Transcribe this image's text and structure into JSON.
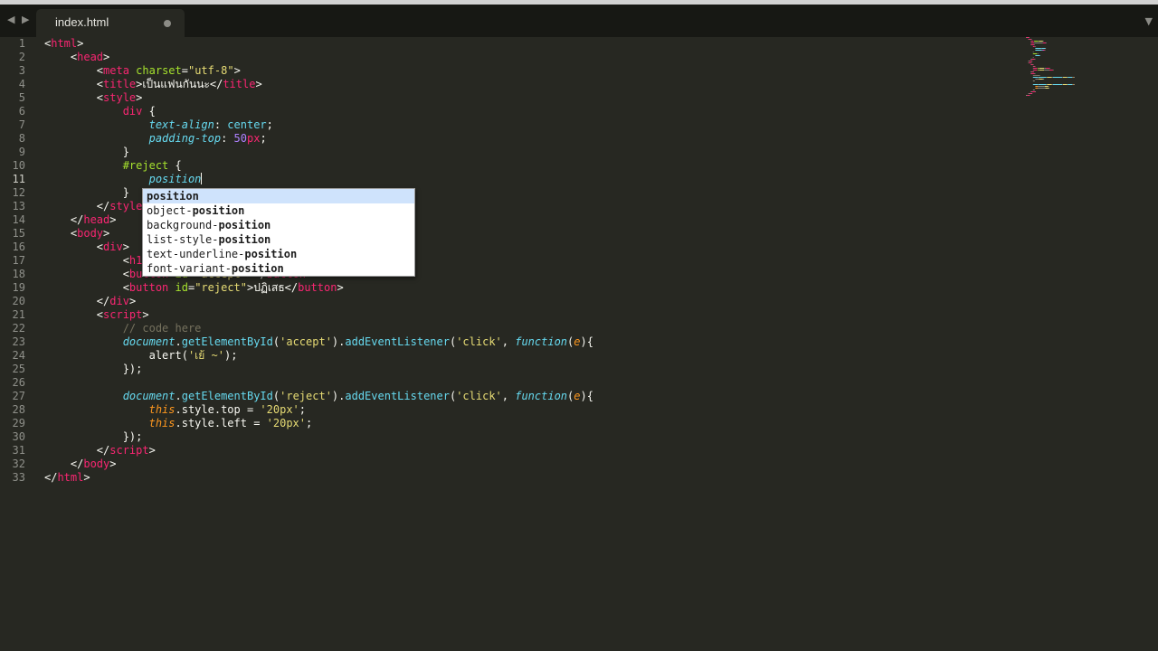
{
  "tabbar": {
    "nav_left_icon": "chevron-left-icon",
    "nav_right_icon": "chevron-right-icon",
    "nav_left_glyph": "◀",
    "nav_right_glyph": "▶",
    "menu_glyph": "▼",
    "tab_title": "index.html",
    "tab_modified": true
  },
  "colors": {
    "background": "#272822",
    "tag": "#f92672",
    "attribute": "#a6e22e",
    "string": "#e6db74",
    "number": "#ae81ff",
    "comment": "#75715e",
    "function": "#66d9ef"
  },
  "editor": {
    "active_line": 11,
    "line_numbers": [
      "1",
      "2",
      "3",
      "4",
      "5",
      "6",
      "7",
      "8",
      "9",
      "10",
      "11",
      "12",
      "13",
      "14",
      "15",
      "16",
      "17",
      "18",
      "19",
      "20",
      "21",
      "22",
      "23",
      "24",
      "25",
      "26",
      "27",
      "28",
      "29",
      "30",
      "31",
      "32",
      "33"
    ],
    "lines": {
      "l1": [
        [
          "",
          "<"
        ],
        [
          "tg",
          "html"
        ],
        [
          "",
          ">"
        ]
      ],
      "l2": [
        [
          "",
          "    <"
        ],
        [
          "tg",
          "head"
        ],
        [
          "",
          ">"
        ]
      ],
      "l3": [
        [
          "",
          "        <"
        ],
        [
          "tg",
          "meta"
        ],
        [
          "",
          " "
        ],
        [
          "at",
          "charset"
        ],
        [
          "",
          "="
        ],
        [
          "st",
          "\"utf-8\""
        ],
        [
          "",
          ">"
        ]
      ],
      "l4": [
        [
          "",
          "        <"
        ],
        [
          "tg",
          "title"
        ],
        [
          "",
          ">เป็นแฟนกันนะ</"
        ],
        [
          "tg",
          "title"
        ],
        [
          "",
          ">"
        ]
      ],
      "l5": [
        [
          "",
          "        <"
        ],
        [
          "tg",
          "style"
        ],
        [
          "",
          ">"
        ]
      ],
      "l6": [
        [
          "",
          "            "
        ],
        [
          "tg",
          "div"
        ],
        [
          "",
          " {"
        ]
      ],
      "l7": [
        [
          "",
          "                "
        ],
        [
          "cp",
          "text-align"
        ],
        [
          "",
          ": "
        ],
        [
          "fn",
          "center"
        ],
        [
          "",
          ";"
        ]
      ],
      "l8": [
        [
          "",
          "                "
        ],
        [
          "cp",
          "padding-top"
        ],
        [
          "",
          ": "
        ],
        [
          "nm",
          "50"
        ],
        [
          "kw",
          "px"
        ],
        [
          "",
          ";"
        ]
      ],
      "l9": [
        [
          "",
          "            }"
        ]
      ],
      "l10": [
        [
          "",
          "            "
        ],
        [
          "id",
          "#reject"
        ],
        [
          "",
          " {"
        ]
      ],
      "l11": [
        [
          "",
          "                "
        ],
        [
          "cp",
          "position"
        ]
      ],
      "l12": [
        [
          "",
          "            }"
        ]
      ],
      "l13": [
        [
          "",
          "        </"
        ],
        [
          "tg",
          "style"
        ],
        [
          "",
          ">"
        ]
      ],
      "l14": [
        [
          "",
          "    </"
        ],
        [
          "tg",
          "head"
        ],
        [
          "",
          ">"
        ]
      ],
      "l15": [
        [
          "",
          "    <"
        ],
        [
          "tg",
          "body"
        ],
        [
          "",
          ">"
        ]
      ],
      "l16": [
        [
          "",
          "        <"
        ],
        [
          "tg",
          "div"
        ],
        [
          "",
          ">"
        ]
      ],
      "l17": [
        [
          "",
          "            <"
        ],
        [
          "tg",
          "h1"
        ],
        [
          "",
          ">"
        ]
      ],
      "l18": [
        [
          "",
          "            <"
        ],
        [
          "tg",
          "button"
        ],
        [
          "",
          " "
        ],
        [
          "at",
          "id"
        ],
        [
          "",
          "="
        ],
        [
          "st",
          "\"accept\""
        ],
        [
          "",
          ">"
        ],
        [
          "",
          "</"
        ],
        [
          "tg",
          "button"
        ],
        [
          "",
          ">"
        ]
      ],
      "l19": [
        [
          "",
          "            <"
        ],
        [
          "tg",
          "button"
        ],
        [
          "",
          " "
        ],
        [
          "at",
          "id"
        ],
        [
          "",
          "="
        ],
        [
          "st",
          "\"reject\""
        ],
        [
          "",
          ">ปฏิเสธ</"
        ],
        [
          "tg",
          "button"
        ],
        [
          "",
          ">"
        ]
      ],
      "l20": [
        [
          "",
          "        </"
        ],
        [
          "tg",
          "div"
        ],
        [
          "",
          ">"
        ]
      ],
      "l21": [
        [
          "",
          "        <"
        ],
        [
          "tg",
          "script"
        ],
        [
          "",
          ">"
        ]
      ],
      "l22": [
        [
          "cm",
          "            // code here"
        ]
      ],
      "l23": [
        [
          "",
          "            "
        ],
        [
          "it",
          "document"
        ],
        [
          "",
          "."
        ],
        [
          "fn",
          "getElementById"
        ],
        [
          "",
          "("
        ],
        [
          "st",
          "'accept'"
        ],
        [
          "",
          ")."
        ],
        [
          "fn",
          "addEventListener"
        ],
        [
          "",
          "("
        ],
        [
          "st",
          "'click'"
        ],
        [
          "",
          ", "
        ],
        [
          "it",
          "function"
        ],
        [
          "",
          "("
        ],
        [
          "pa",
          "e"
        ],
        [
          "",
          "){"
        ]
      ],
      "l24": [
        [
          "",
          "                "
        ],
        [
          "",
          "alert("
        ],
        [
          "st",
          "'เย้ ~'"
        ],
        [
          "",
          ");"
        ]
      ],
      "l25": [
        [
          "",
          "            });"
        ]
      ],
      "l26": [
        [
          "",
          ""
        ]
      ],
      "l27": [
        [
          "",
          "            "
        ],
        [
          "it",
          "document"
        ],
        [
          "",
          "."
        ],
        [
          "fn",
          "getElementById"
        ],
        [
          "",
          "("
        ],
        [
          "st",
          "'reject'"
        ],
        [
          "",
          ")."
        ],
        [
          "fn",
          "addEventListener"
        ],
        [
          "",
          "("
        ],
        [
          "st",
          "'click'"
        ],
        [
          "",
          ", "
        ],
        [
          "it",
          "function"
        ],
        [
          "",
          "("
        ],
        [
          "pa",
          "e"
        ],
        [
          "",
          "){"
        ]
      ],
      "l28": [
        [
          "",
          "                "
        ],
        [
          "th",
          "this"
        ],
        [
          "",
          ".style.top = "
        ],
        [
          "st",
          "'20px'"
        ],
        [
          "",
          ";"
        ]
      ],
      "l29": [
        [
          "",
          "                "
        ],
        [
          "th",
          "this"
        ],
        [
          "",
          ".style.left = "
        ],
        [
          "st",
          "'20px'"
        ],
        [
          "",
          ";"
        ]
      ],
      "l30": [
        [
          "",
          "            });"
        ]
      ],
      "l31": [
        [
          "",
          "        </"
        ],
        [
          "tg",
          "script"
        ],
        [
          "",
          ">"
        ]
      ],
      "l32": [
        [
          "",
          "    </"
        ],
        [
          "tg",
          "body"
        ],
        [
          "",
          ">"
        ]
      ],
      "l33": [
        [
          "",
          "</"
        ],
        [
          "tg",
          "html"
        ],
        [
          "",
          ">"
        ]
      ]
    }
  },
  "autocomplete": {
    "items": [
      {
        "prefix": "",
        "match": "position"
      },
      {
        "prefix": "object-",
        "match": "position"
      },
      {
        "prefix": "background-",
        "match": "position"
      },
      {
        "prefix": "list-style-",
        "match": "position"
      },
      {
        "prefix": "text-underline-",
        "match": "position"
      },
      {
        "prefix": "font-variant-",
        "match": "position"
      }
    ],
    "selected_index": 0
  },
  "minimap": {
    "label": "minimap"
  }
}
